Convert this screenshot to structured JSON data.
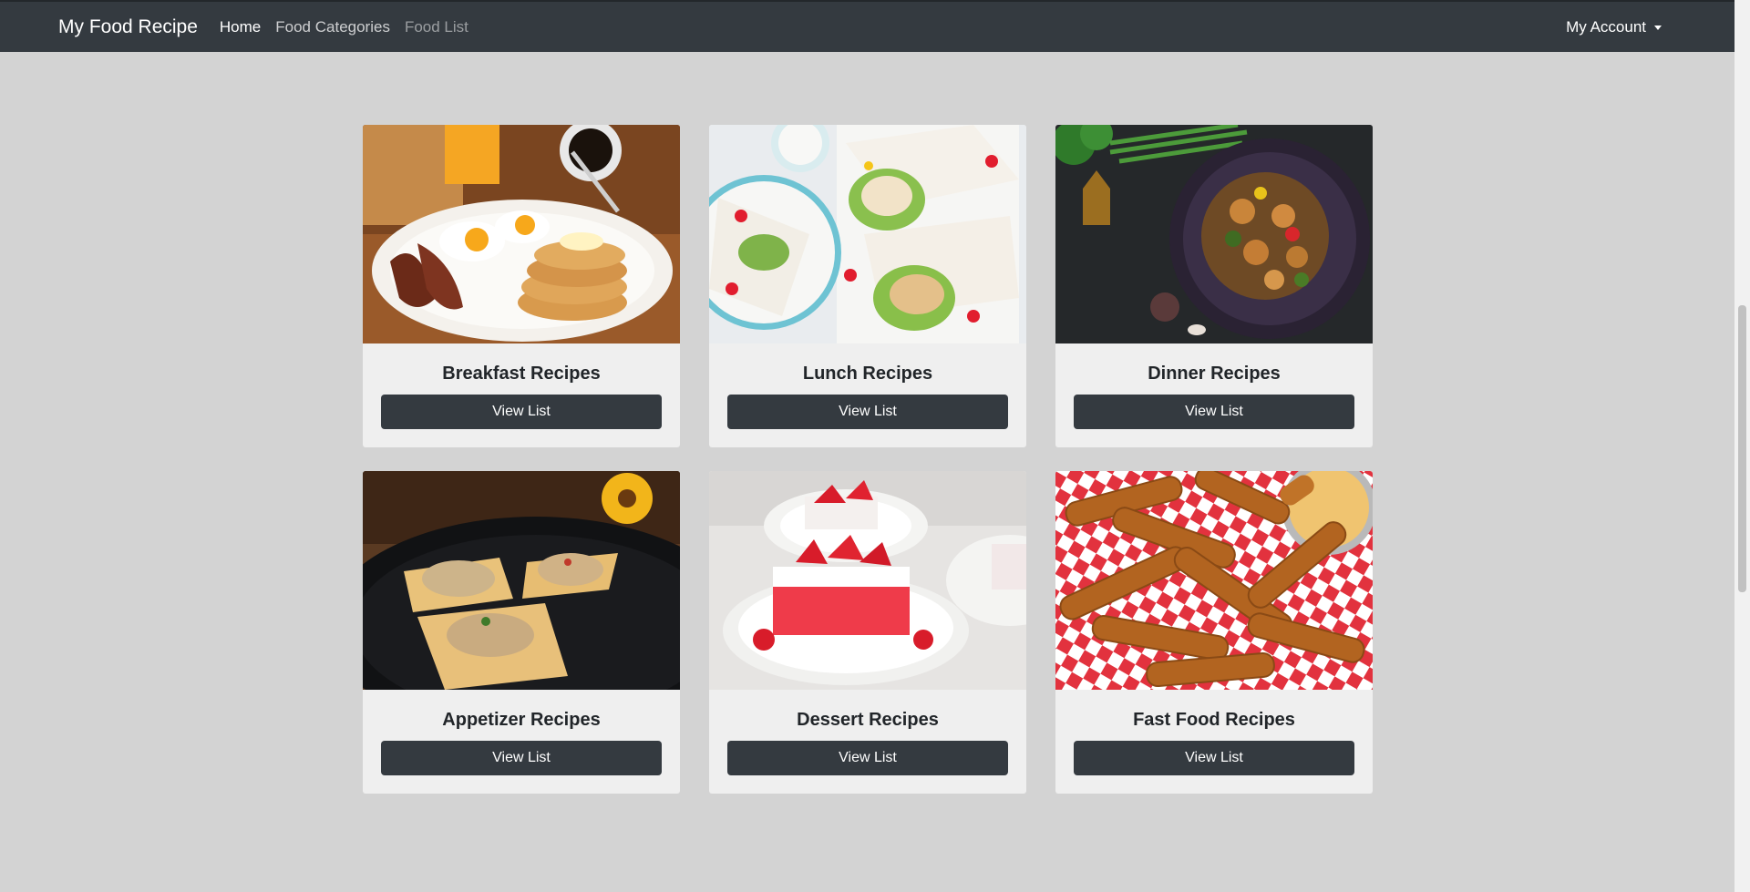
{
  "navbar": {
    "brand": "My Food Recipe",
    "links": [
      {
        "label": "Home"
      },
      {
        "label": "Food Categories"
      },
      {
        "label": "Food List"
      }
    ],
    "account_label": "My Account"
  },
  "categories": [
    {
      "title": "Breakfast Recipes",
      "button": "View List"
    },
    {
      "title": "Lunch Recipes",
      "button": "View List"
    },
    {
      "title": "Dinner Recipes",
      "button": "View List"
    },
    {
      "title": "Appetizer Recipes",
      "button": "View List"
    },
    {
      "title": "Dessert Recipes",
      "button": "View List"
    },
    {
      "title": "Fast Food Recipes",
      "button": "View List"
    }
  ],
  "colors": {
    "navbar_bg": "#343a40",
    "page_bg": "#d3d3d3",
    "card_bg": "#efefef",
    "button_bg": "#343a40"
  }
}
